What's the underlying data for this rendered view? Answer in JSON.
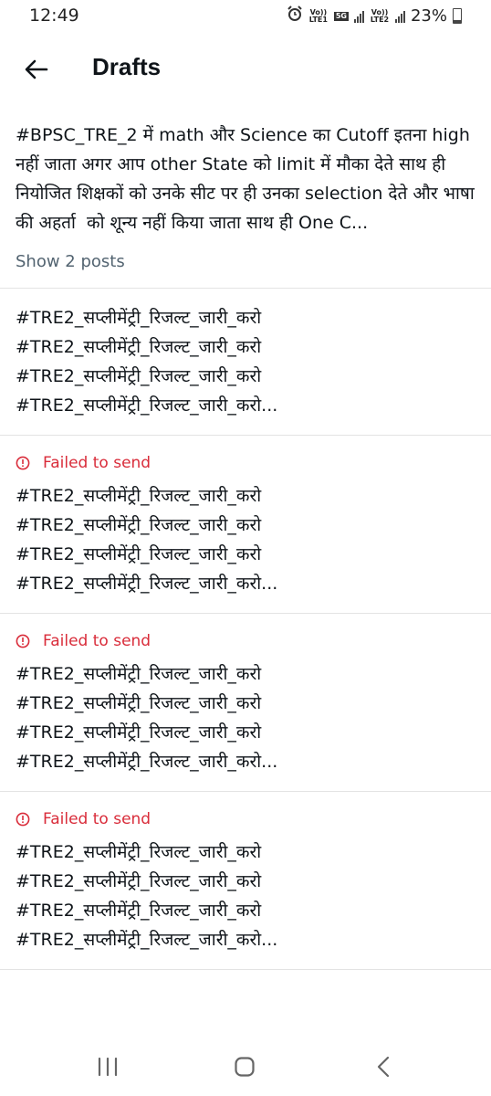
{
  "status_bar": {
    "time": "12:49",
    "sim1_label": "Vo)) LTE1",
    "net_label": "5G",
    "sim2_label": "Vo)) LTE2",
    "battery": "23%"
  },
  "header": {
    "title": "Drafts",
    "back_icon": "arrow-left-icon"
  },
  "drafts": [
    {
      "text": "#BPSC_TRE_2 में math और Science का Cutoff इतना high नहीं जाता अगर आप other State को limit में मौका देते साथ ही नियोजित शिक्षकों को उनके सीट पर ही उनका selection देते और भाषा की अहर्ता  को शून्य नहीं किया जाता साथ ही One C...",
      "show_posts": "Show 2 posts"
    },
    {
      "text": "#TRE2_सप्लीमेंट्री_रिजल्ट_जारी_करो\n#TRE2_सप्लीमेंट्री_रिजल्ट_जारी_करो\n#TRE2_सप्लीमेंट्री_रिजल्ट_जारी_करो\n#TRE2_सप्लीमेंट्री_रिजल्ट_जारी_करो..."
    },
    {
      "status": "Failed to send",
      "text": "#TRE2_सप्लीमेंट्री_रिजल्ट_जारी_करो\n#TRE2_सप्लीमेंट्री_रिजल्ट_जारी_करो\n#TRE2_सप्लीमेंट्री_रिजल्ट_जारी_करो\n#TRE2_सप्लीमेंट्री_रिजल्ट_जारी_करो..."
    },
    {
      "status": "Failed to send",
      "text": "#TRE2_सप्लीमेंट्री_रिजल्ट_जारी_करो\n#TRE2_सप्लीमेंट्री_रिजल्ट_जारी_करो\n#TRE2_सप्लीमेंट्री_रिजल्ट_जारी_करो\n#TRE2_सप्लीमेंट्री_रिजल्ट_जारी_करो..."
    },
    {
      "status": "Failed to send",
      "text": "#TRE2_सप्लीमेंट्री_रिजल्ट_जारी_करो\n#TRE2_सप्लीमेंट्री_रिजल्ट_जारी_करो\n#TRE2_सप्लीमेंट्री_रिजल्ट_जारी_करो\n#TRE2_सप्लीमेंट्री_रिजल्ट_जारी_करो..."
    }
  ],
  "colors": {
    "error": "#d92c3a",
    "secondary_text": "#536471",
    "divider": "#e3e3e3"
  },
  "nav_bar": {
    "recents_icon": "recents-icon",
    "home_icon": "home-icon",
    "back_icon": "nav-back-icon"
  }
}
